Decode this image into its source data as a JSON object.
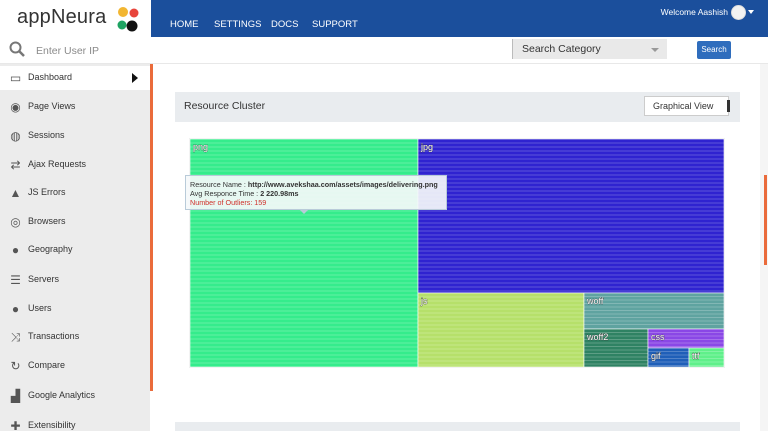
{
  "app": {
    "logo": "appNeura"
  },
  "nav": {
    "items": [
      "HOME",
      "SETTINGS",
      "DOCS",
      "SUPPORT"
    ]
  },
  "user": {
    "welcome": "Welcome Aashish"
  },
  "search": {
    "placeholder": "Enter User IP",
    "category": "Search Category",
    "button": "Search"
  },
  "sidebar": {
    "items": [
      {
        "label": "Dashboard",
        "icon": "monitor-icon",
        "glyph": "▭"
      },
      {
        "label": "Page Views",
        "icon": "eye-icon",
        "glyph": "◉"
      },
      {
        "label": "Sessions",
        "icon": "globe-icon",
        "glyph": "◍"
      },
      {
        "label": "Ajax Requests",
        "icon": "exchange-icon",
        "glyph": "⇄"
      },
      {
        "label": "JS Errors",
        "icon": "warning-icon",
        "glyph": "▲"
      },
      {
        "label": "Browsers",
        "icon": "compass-icon",
        "glyph": "◎"
      },
      {
        "label": "Geography",
        "icon": "globe-icon",
        "glyph": "●"
      },
      {
        "label": "Servers",
        "icon": "server-icon",
        "glyph": "☰"
      },
      {
        "label": "Users",
        "icon": "user-icon",
        "glyph": "●"
      },
      {
        "label": "Transactions",
        "icon": "shuffle-icon",
        "glyph": "⤨"
      },
      {
        "label": "Compare",
        "icon": "refresh-icon",
        "glyph": "↻"
      },
      {
        "label": "Google Analytics",
        "icon": "bar-chart-icon",
        "glyph": "▟"
      },
      {
        "label": "Extensibility",
        "icon": "puzzle-icon",
        "glyph": "✚"
      }
    ]
  },
  "panel": {
    "title": "Resource Cluster",
    "view": "Graphical View"
  },
  "treemap": {
    "cells": [
      {
        "label": "png",
        "color": "#35ec8c"
      },
      {
        "label": "jpg",
        "color": "#2f23d0"
      },
      {
        "label": "js",
        "color": "#b6e06a"
      },
      {
        "label": "woff",
        "color": "#5fa3a0"
      },
      {
        "label": "woff2",
        "color": "#2f8263"
      },
      {
        "label": "css",
        "color": "#8a47e6"
      },
      {
        "label": "gif",
        "color": "#1f5fb8"
      },
      {
        "label": "ttf",
        "color": "#5ff08a"
      }
    ]
  },
  "tooltip": {
    "name_label": "Resource Name : ",
    "name_value": "http://www.avekshaa.com/assets/images/delivering.png",
    "time_label": "Avg Responce Time : ",
    "time_value": "2 220.98ms",
    "outliers": "Number of Outliers: 159"
  }
}
